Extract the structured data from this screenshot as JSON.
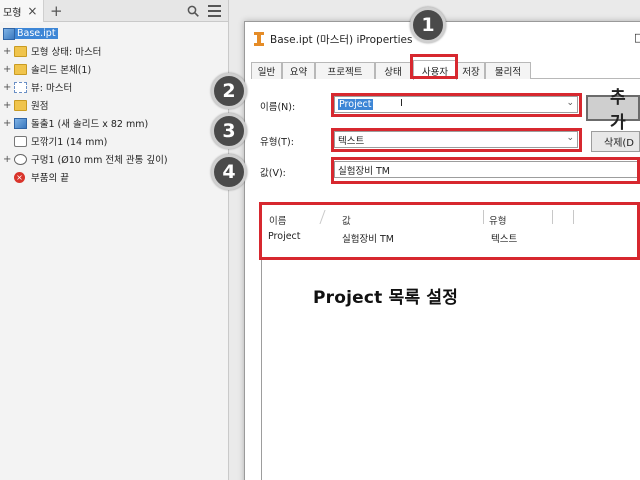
{
  "browser": {
    "tab_label": "모형",
    "tab_close": "×",
    "add_tab": "+",
    "items": [
      {
        "label": "Base.ipt",
        "icon": "part-icon",
        "expander": "",
        "selected": true
      },
      {
        "label": "모형 상태: 마스터",
        "icon": "folder-icon",
        "expander": "+"
      },
      {
        "label": "솔리드 본체(1)",
        "icon": "folder-icon",
        "expander": "+"
      },
      {
        "label": "뷰: 마스터",
        "icon": "view-icon",
        "expander": "+"
      },
      {
        "label": "원점",
        "icon": "folder-icon",
        "expander": "+"
      },
      {
        "label": "돌출1 (새 솔리드 x 82 mm)",
        "icon": "extrude-icon",
        "expander": "+"
      },
      {
        "label": "모깎기1 (14 mm)",
        "icon": "fillet-icon",
        "expander": ""
      },
      {
        "label": "구멍1 (Ø10 mm 전체 관통 깊이)",
        "icon": "hole-icon",
        "expander": "+"
      },
      {
        "label": "부품의 끝",
        "icon": "end-of-part-icon",
        "expander": ""
      }
    ]
  },
  "dialog": {
    "title": "Base.ipt (마스터) iProperties",
    "close_label": "□",
    "tabs": [
      "일반",
      "요약",
      "프로젝트",
      "상태",
      "사용자",
      "저장",
      "물리적"
    ],
    "active_tab": "사용자",
    "name_label": "이름(N):",
    "name_value": "Project",
    "type_label": "유형(T):",
    "type_value": "텍스트",
    "value_label": "값(V):",
    "value_value": "실험장비 TM",
    "add_button": "추가",
    "delete_button": "삭제(D",
    "list": {
      "headers": [
        "이름",
        "값",
        "유형"
      ],
      "rows": [
        {
          "name": "Project",
          "value": "실험장비 TM",
          "type": "텍스트"
        }
      ]
    }
  },
  "caption": "Project 목록 설정",
  "callouts": [
    "1",
    "2",
    "3",
    "4"
  ],
  "colors": {
    "annotation_red": "#d7282f",
    "selection_blue": "#3d86d6",
    "callout_dark": "#4a4a4a"
  }
}
